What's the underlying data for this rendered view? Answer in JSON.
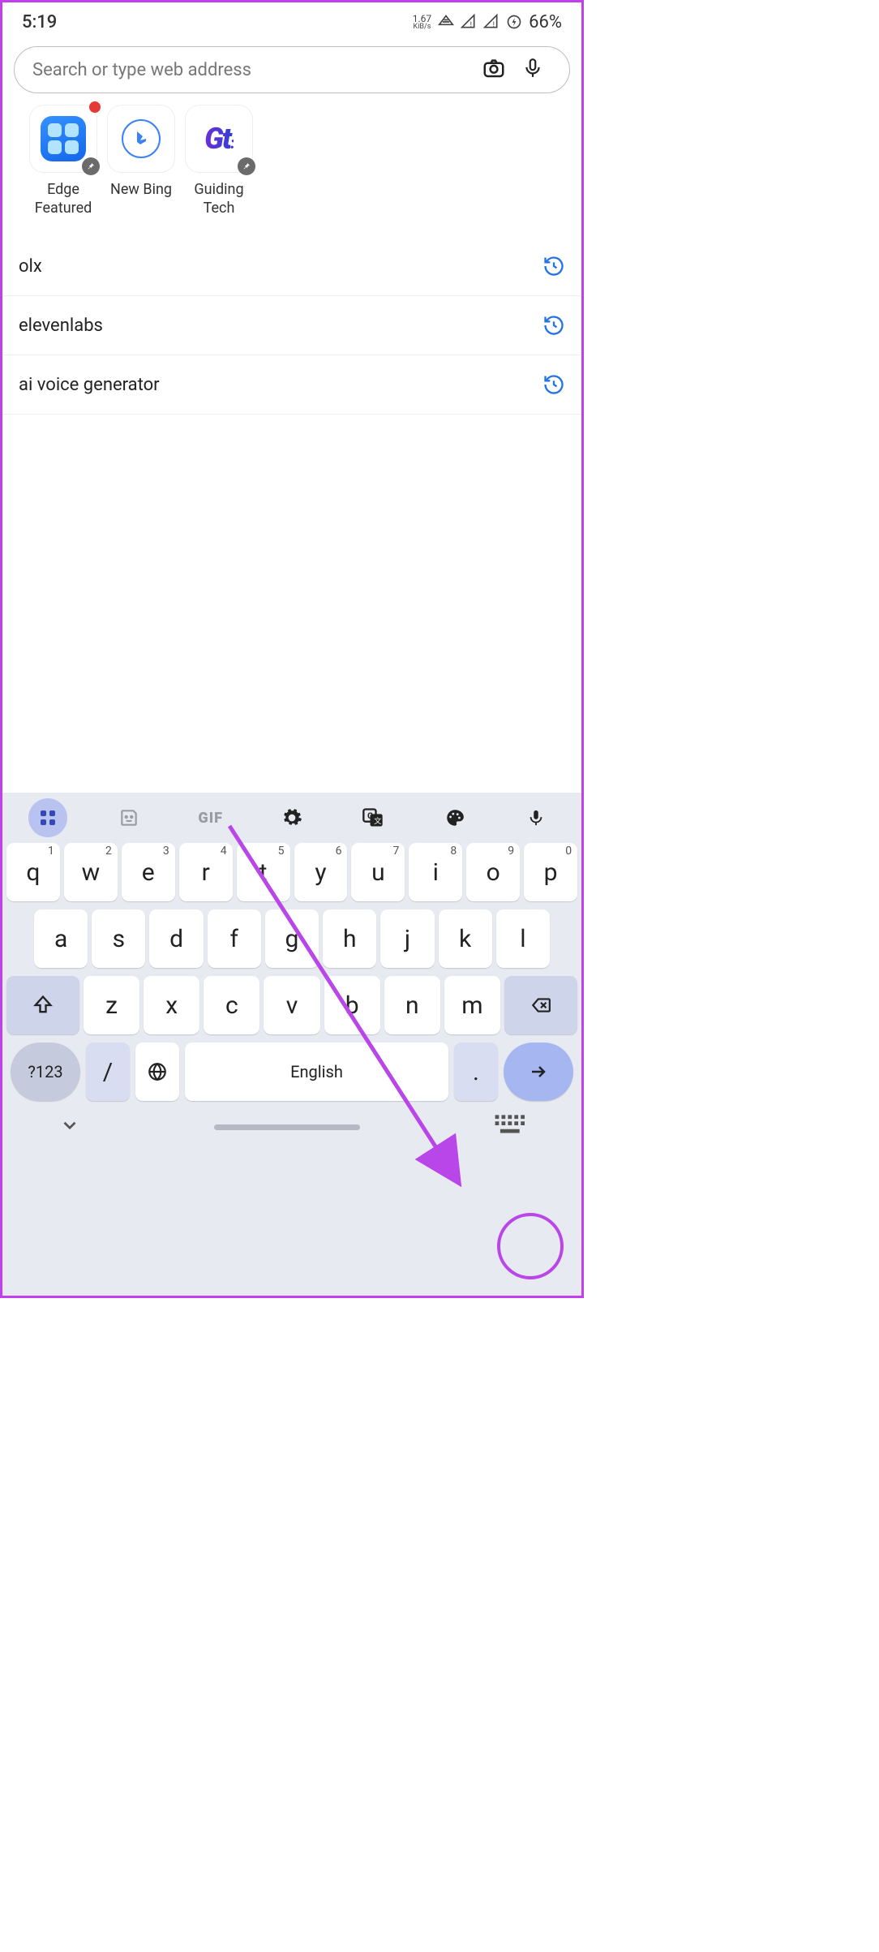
{
  "status": {
    "time": "5:19",
    "data_rate": "1.67",
    "data_unit": "KiB/s",
    "battery": "66%"
  },
  "search": {
    "placeholder": "Search or type web address"
  },
  "shortcuts": [
    {
      "label": "Edge Featured"
    },
    {
      "label": "New Bing"
    },
    {
      "label": "Guiding Tech"
    }
  ],
  "history": [
    {
      "text": "olx"
    },
    {
      "text": "elevenlabs"
    },
    {
      "text": "ai voice generator"
    }
  ],
  "keyboard": {
    "gif": "GIF",
    "row1": [
      {
        "k": "q",
        "n": "1"
      },
      {
        "k": "w",
        "n": "2"
      },
      {
        "k": "e",
        "n": "3"
      },
      {
        "k": "r",
        "n": "4"
      },
      {
        "k": "t",
        "n": "5"
      },
      {
        "k": "y",
        "n": "6"
      },
      {
        "k": "u",
        "n": "7"
      },
      {
        "k": "i",
        "n": "8"
      },
      {
        "k": "o",
        "n": "9"
      },
      {
        "k": "p",
        "n": "0"
      }
    ],
    "row2": [
      "a",
      "s",
      "d",
      "f",
      "g",
      "h",
      "j",
      "k",
      "l"
    ],
    "row3": [
      "z",
      "x",
      "c",
      "v",
      "b",
      "n",
      "m"
    ],
    "sym": "?123",
    "slash": "/",
    "space": "English",
    "dot": "."
  }
}
